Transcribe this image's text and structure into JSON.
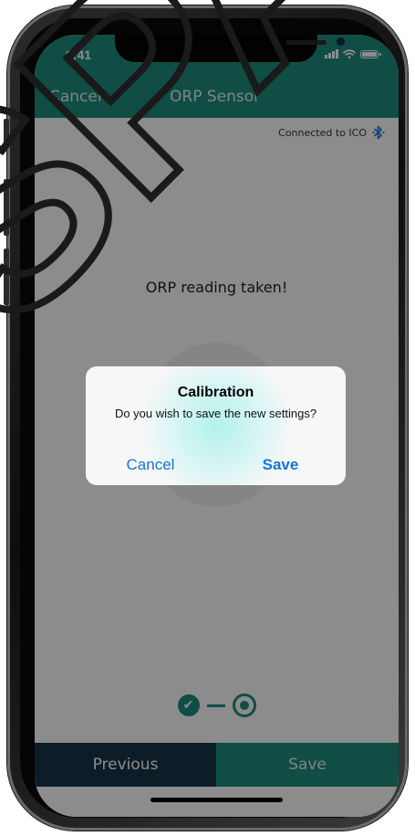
{
  "status_bar": {
    "time": "9:41"
  },
  "nav": {
    "cancel_label": "Cancel",
    "title": "ORP Sensor"
  },
  "connection": {
    "text": "Connected to ICO",
    "icon": "bluetooth-icon"
  },
  "main": {
    "reading_label": "ORP reading taken!"
  },
  "progress": {
    "steps_completed": 1,
    "steps_total": 2,
    "check_icon": "✔"
  },
  "footer": {
    "previous_label": "Previous",
    "save_label": "Save"
  },
  "dialog": {
    "title": "Calibration",
    "message": "Do you wish to save the new settings?",
    "cancel_label": "Cancel",
    "save_label": "Save"
  },
  "watermark": {
    "text": "SPAS"
  },
  "colors": {
    "teal": "#1e8c7f",
    "navy": "#16364a",
    "ios_blue": "#1475d6",
    "bluetooth": "#2a7de1"
  }
}
